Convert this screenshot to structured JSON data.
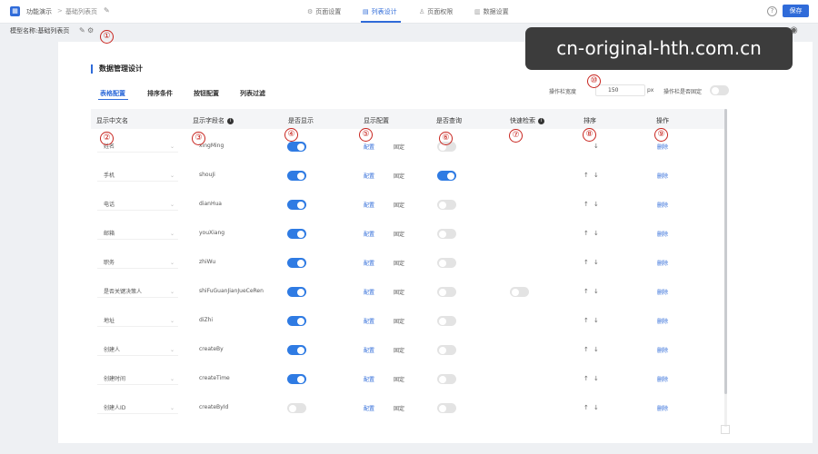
{
  "topbar": {
    "app_icon": "app-grid-icon",
    "breadcrumb_root": "功能演示",
    "breadcrumb_sep": ">",
    "breadcrumb_current": "基础列表页",
    "tabs": [
      {
        "label": "页面设置",
        "icon": "page-settings-icon"
      },
      {
        "label": "列表设计",
        "icon": "list-design-icon"
      },
      {
        "label": "页面权限",
        "icon": "user-permission-icon"
      },
      {
        "label": "数据设置",
        "icon": "chart-icon"
      }
    ],
    "active_tab": "列表设计",
    "save_label": "保存"
  },
  "model": {
    "label": "模型名称:",
    "name": "基础列表页"
  },
  "annotations": [
    "①",
    "②",
    "③",
    "④",
    "⑤",
    "⑥",
    "⑦",
    "⑧",
    "⑨",
    "⑩"
  ],
  "watermark": "cn-original-hth.com.cn",
  "section_title": "数据管理设计",
  "sub_tabs": [
    "表格配置",
    "排序条件",
    "按钮配置",
    "列表过滤"
  ],
  "active_sub_tab": "表格配置",
  "action_width": {
    "label": "操作栏宽度",
    "value": "150",
    "unit": "px",
    "fixed_label": "操作栏是否固定",
    "fixed": false
  },
  "columns": [
    "显示中文名",
    "显示字段名",
    "是否显示",
    "显示配置",
    "是否查询",
    "快速检索",
    "排序",
    "操作"
  ],
  "rows": [
    {
      "cn": "姓名",
      "field": "xingMing",
      "show": true,
      "config": "配置",
      "fixed": "固定",
      "query": false,
      "quick": null,
      "up": false,
      "down": true,
      "action": "删除"
    },
    {
      "cn": "手机",
      "field": "shouJi",
      "show": true,
      "config": "配置",
      "fixed": "固定",
      "query": true,
      "quick": null,
      "up": true,
      "down": true,
      "action": "删除"
    },
    {
      "cn": "电话",
      "field": "dianHua",
      "show": true,
      "config": "配置",
      "fixed": "固定",
      "query": false,
      "quick": null,
      "up": true,
      "down": true,
      "action": "删除"
    },
    {
      "cn": "邮箱",
      "field": "youXiang",
      "show": true,
      "config": "配置",
      "fixed": "固定",
      "query": false,
      "quick": null,
      "up": true,
      "down": true,
      "action": "删除"
    },
    {
      "cn": "职务",
      "field": "zhiWu",
      "show": true,
      "config": "配置",
      "fixed": "固定",
      "query": false,
      "quick": null,
      "up": true,
      "down": true,
      "action": "删除"
    },
    {
      "cn": "是否关键决策人",
      "field": "shiFuGuanJianJueCeRen",
      "show": true,
      "config": "配置",
      "fixed": "固定",
      "query": false,
      "quick": false,
      "up": true,
      "down": true,
      "action": "删除"
    },
    {
      "cn": "地址",
      "field": "diZhi",
      "show": true,
      "config": "配置",
      "fixed": "固定",
      "query": false,
      "quick": null,
      "up": true,
      "down": true,
      "action": "删除"
    },
    {
      "cn": "创建人",
      "field": "createBy",
      "show": true,
      "config": "配置",
      "fixed": "固定",
      "query": false,
      "quick": null,
      "up": true,
      "down": true,
      "action": "删除"
    },
    {
      "cn": "创建时间",
      "field": "createTime",
      "show": true,
      "config": "配置",
      "fixed": "固定",
      "query": false,
      "quick": null,
      "up": true,
      "down": true,
      "action": "删除"
    },
    {
      "cn": "创建人ID",
      "field": "createById",
      "show": false,
      "config": "配置",
      "fixed": "固定",
      "query": false,
      "quick": null,
      "up": true,
      "down": true,
      "action": "删除"
    }
  ],
  "colors": {
    "accent": "#2f6bd9",
    "annotation": "#c8251f",
    "toggle_on": "#2f7be3"
  }
}
